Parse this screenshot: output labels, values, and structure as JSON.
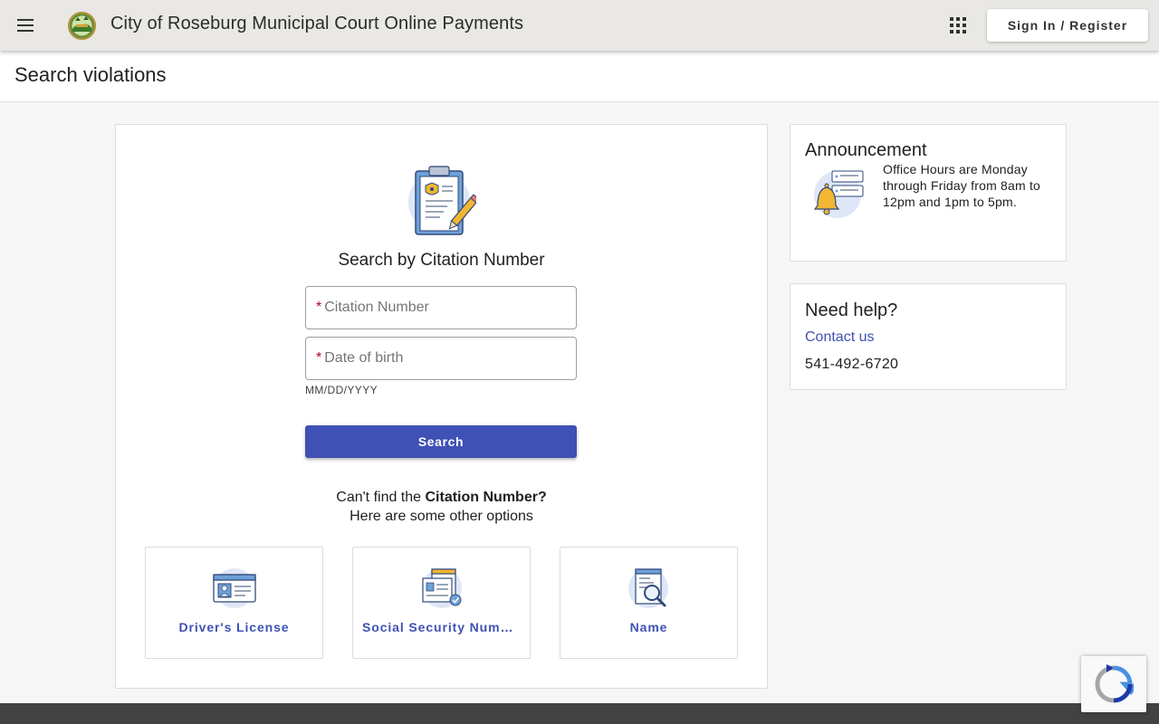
{
  "header": {
    "title": "City of Roseburg Municipal Court Online Payments",
    "sign_in_label": "Sign In / Register"
  },
  "page": {
    "title": "Search violations"
  },
  "search": {
    "heading": "Search by Citation Number",
    "citation_placeholder": "Citation Number",
    "dob_placeholder": "Date of birth",
    "required_marker": "*",
    "dob_hint": "MM/DD/YYYY",
    "search_button": "Search",
    "cant_find_prefix": "Can't find the ",
    "cant_find_bold": "Citation Number?",
    "cant_find_line2": "Here are some other options"
  },
  "options": [
    {
      "label": "Driver's License",
      "icon": "id-card-icon"
    },
    {
      "label": "Social Security Number",
      "icon": "ssn-document-icon"
    },
    {
      "label": "Name",
      "icon": "document-search-icon"
    }
  ],
  "announcement": {
    "title": "Announcement",
    "text": "Office Hours are Monday through Friday from 8am to 12pm and 1pm to 5pm."
  },
  "help": {
    "title": "Need help?",
    "contact_label": "Contact us",
    "phone": "541-492-6720"
  },
  "colors": {
    "primary": "#3f51b5",
    "appbar": "#e9e8e5",
    "required": "#b00020",
    "footer": "#424242"
  }
}
